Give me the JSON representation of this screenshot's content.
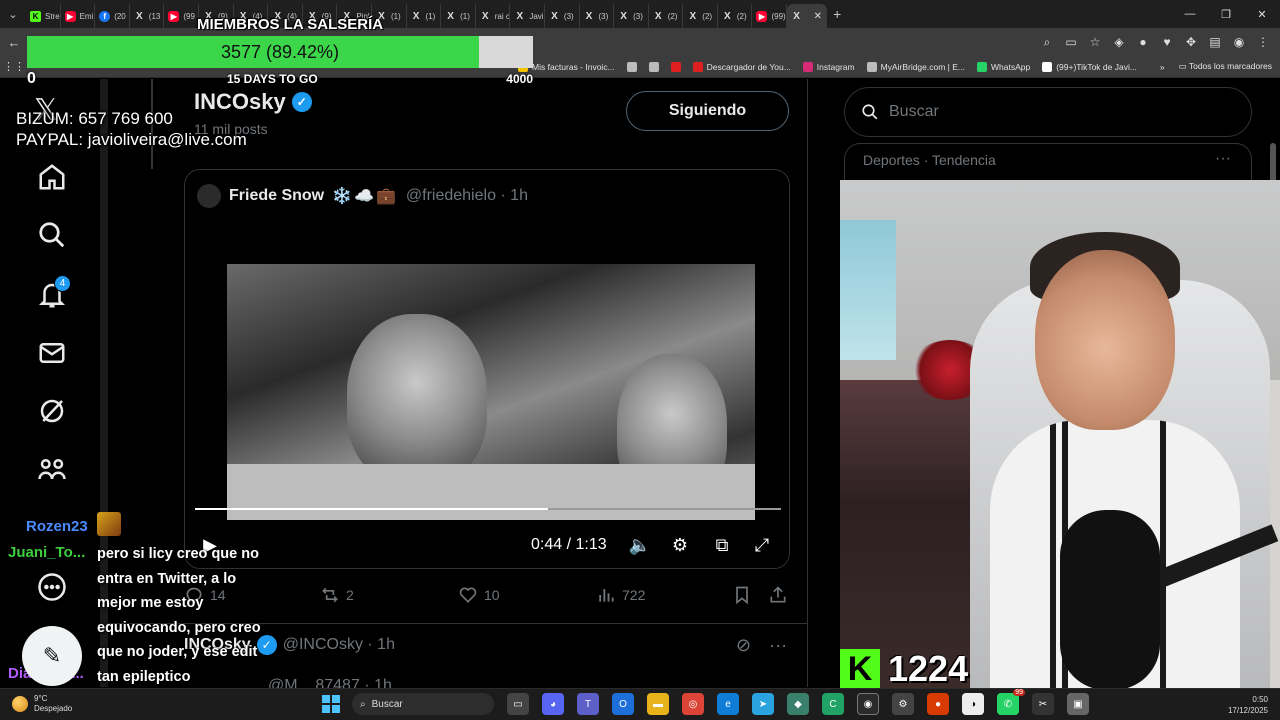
{
  "browser": {
    "tabs": [
      {
        "label": "Stre",
        "icon": "kick-icon"
      },
      {
        "label": "Emi",
        "icon": "youtube-icon"
      },
      {
        "label": "(20",
        "icon": "facebook-icon"
      },
      {
        "label": "(13",
        "icon": "x-icon"
      },
      {
        "label": "(99",
        "icon": "youtube-icon"
      },
      {
        "label": "(9)",
        "icon": "x-icon"
      },
      {
        "label": "(4)",
        "icon": "x-icon"
      },
      {
        "label": "(4)",
        "icon": "x-icon"
      },
      {
        "label": "(9)",
        "icon": "x-icon"
      },
      {
        "label": "Pinl",
        "icon": "x-icon"
      },
      {
        "label": "(1)",
        "icon": "x-icon"
      },
      {
        "label": "(1)",
        "icon": "x-icon"
      },
      {
        "label": "(1)",
        "icon": "x-icon"
      },
      {
        "label": "rai c",
        "icon": "x-icon"
      },
      {
        "label": "Javi",
        "icon": "x-icon"
      },
      {
        "label": "(3)",
        "icon": "x-icon"
      },
      {
        "label": "(3)",
        "icon": "x-icon"
      },
      {
        "label": "(3)",
        "icon": "x-icon"
      },
      {
        "label": "(2)",
        "icon": "x-icon"
      },
      {
        "label": "(2)",
        "icon": "x-icon"
      },
      {
        "label": "(2)",
        "icon": "x-icon"
      },
      {
        "label": "(99)",
        "icon": "youtube-icon"
      },
      {
        "label": "",
        "icon": "x-icon",
        "active": true
      }
    ],
    "bookmarks": [
      {
        "label": "Mis facturas - Invoic...",
        "color": "#f5c400"
      },
      {
        "label": "",
        "color": "#bbbbbb"
      },
      {
        "label": "",
        "color": "#bbbbbb"
      },
      {
        "label": "",
        "color": "#e02020"
      },
      {
        "label": "Descargador de You...",
        "color": "#e02020"
      },
      {
        "label": "Instagram",
        "color": "#d62976"
      },
      {
        "label": "MyAirBridge.com | E...",
        "color": "#bbbbbb"
      },
      {
        "label": "WhatsApp",
        "color": "#25d366"
      },
      {
        "label": "(99+)TikTok de Javi...",
        "color": "#ffffff"
      }
    ],
    "bookmarks_more": "Todos los marcadores"
  },
  "overlay": {
    "goal_title": "MIEMBROS LA SALSERÍA",
    "goal_value": "3577 (89.42%)",
    "goal_fraction": 0.8942,
    "goal_min": "0",
    "goal_days": "15 DAYS TO GO",
    "goal_max": "4000",
    "donate_bizum": "BIZUM: 657 769 600",
    "donate_paypal": "PAYPAL: javioliveira@live.com",
    "kick_viewers": "1224",
    "kick_letter": "K"
  },
  "x": {
    "profile_name": "INCOsky",
    "profile_posts": "11 mil posts",
    "follow_label": "Siguiendo",
    "notif_count": "4",
    "quote": {
      "name": "Friede Snow",
      "emoji": "❄️☁️💼",
      "handle": "@friedehielo · 1h"
    },
    "video": {
      "time": "0:44 / 1:13",
      "progress": 0.6027
    },
    "actions": {
      "replies": "14",
      "reposts": "2",
      "likes": "10",
      "views": "722"
    },
    "reply": {
      "name": "INCOsky",
      "handle": "@INCOsky · 1h"
    },
    "next_handle": "@M... 87487 · 1h",
    "search_placeholder": "Buscar",
    "trend_label": "Deportes · Tendencia"
  },
  "chat": {
    "user1": "Rozen23",
    "user1_color": "#4a8bff",
    "user2": "Juani_To...",
    "user2_color": "#3ecf3e",
    "user3": "Diablosh...",
    "user3_color": "#b05cff",
    "message": "pero si licy creo que no entra en Twitter, a lo mejor me estoy equivocando, pero creo que no joder, y ese edit tan epileptico"
  },
  "taskbar": {
    "weather_temp": "9°C",
    "weather_desc": "Despejado",
    "search_label": "Buscar",
    "time": "0:50",
    "date": "17/12/2025",
    "notif_badge": "99"
  }
}
